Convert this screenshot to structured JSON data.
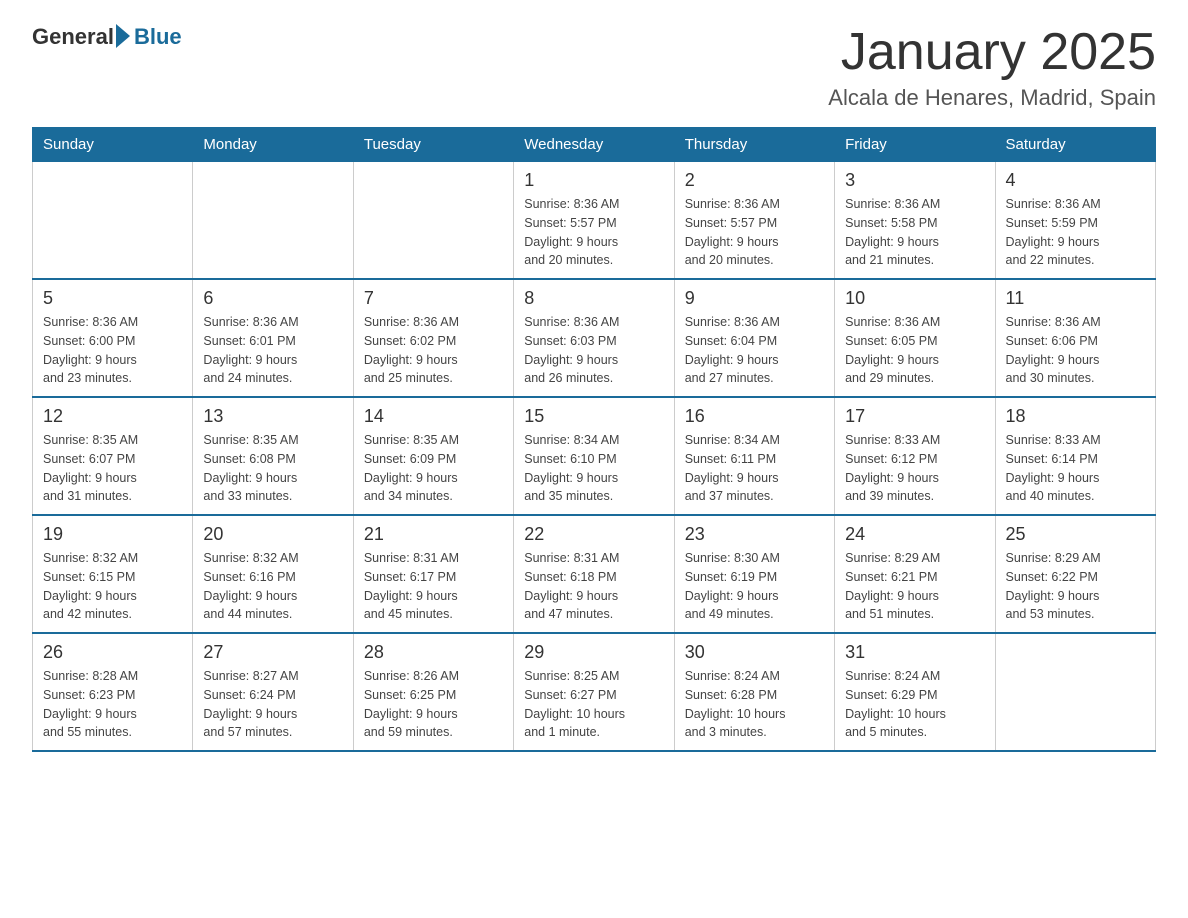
{
  "logo": {
    "text_general": "General",
    "text_blue": "Blue"
  },
  "header": {
    "title": "January 2025",
    "location": "Alcala de Henares, Madrid, Spain"
  },
  "days_of_week": [
    "Sunday",
    "Monday",
    "Tuesday",
    "Wednesday",
    "Thursday",
    "Friday",
    "Saturday"
  ],
  "weeks": [
    {
      "days": [
        {
          "num": "",
          "info": ""
        },
        {
          "num": "",
          "info": ""
        },
        {
          "num": "",
          "info": ""
        },
        {
          "num": "1",
          "info": "Sunrise: 8:36 AM\nSunset: 5:57 PM\nDaylight: 9 hours\nand 20 minutes."
        },
        {
          "num": "2",
          "info": "Sunrise: 8:36 AM\nSunset: 5:57 PM\nDaylight: 9 hours\nand 20 minutes."
        },
        {
          "num": "3",
          "info": "Sunrise: 8:36 AM\nSunset: 5:58 PM\nDaylight: 9 hours\nand 21 minutes."
        },
        {
          "num": "4",
          "info": "Sunrise: 8:36 AM\nSunset: 5:59 PM\nDaylight: 9 hours\nand 22 minutes."
        }
      ]
    },
    {
      "days": [
        {
          "num": "5",
          "info": "Sunrise: 8:36 AM\nSunset: 6:00 PM\nDaylight: 9 hours\nand 23 minutes."
        },
        {
          "num": "6",
          "info": "Sunrise: 8:36 AM\nSunset: 6:01 PM\nDaylight: 9 hours\nand 24 minutes."
        },
        {
          "num": "7",
          "info": "Sunrise: 8:36 AM\nSunset: 6:02 PM\nDaylight: 9 hours\nand 25 minutes."
        },
        {
          "num": "8",
          "info": "Sunrise: 8:36 AM\nSunset: 6:03 PM\nDaylight: 9 hours\nand 26 minutes."
        },
        {
          "num": "9",
          "info": "Sunrise: 8:36 AM\nSunset: 6:04 PM\nDaylight: 9 hours\nand 27 minutes."
        },
        {
          "num": "10",
          "info": "Sunrise: 8:36 AM\nSunset: 6:05 PM\nDaylight: 9 hours\nand 29 minutes."
        },
        {
          "num": "11",
          "info": "Sunrise: 8:36 AM\nSunset: 6:06 PM\nDaylight: 9 hours\nand 30 minutes."
        }
      ]
    },
    {
      "days": [
        {
          "num": "12",
          "info": "Sunrise: 8:35 AM\nSunset: 6:07 PM\nDaylight: 9 hours\nand 31 minutes."
        },
        {
          "num": "13",
          "info": "Sunrise: 8:35 AM\nSunset: 6:08 PM\nDaylight: 9 hours\nand 33 minutes."
        },
        {
          "num": "14",
          "info": "Sunrise: 8:35 AM\nSunset: 6:09 PM\nDaylight: 9 hours\nand 34 minutes."
        },
        {
          "num": "15",
          "info": "Sunrise: 8:34 AM\nSunset: 6:10 PM\nDaylight: 9 hours\nand 35 minutes."
        },
        {
          "num": "16",
          "info": "Sunrise: 8:34 AM\nSunset: 6:11 PM\nDaylight: 9 hours\nand 37 minutes."
        },
        {
          "num": "17",
          "info": "Sunrise: 8:33 AM\nSunset: 6:12 PM\nDaylight: 9 hours\nand 39 minutes."
        },
        {
          "num": "18",
          "info": "Sunrise: 8:33 AM\nSunset: 6:14 PM\nDaylight: 9 hours\nand 40 minutes."
        }
      ]
    },
    {
      "days": [
        {
          "num": "19",
          "info": "Sunrise: 8:32 AM\nSunset: 6:15 PM\nDaylight: 9 hours\nand 42 minutes."
        },
        {
          "num": "20",
          "info": "Sunrise: 8:32 AM\nSunset: 6:16 PM\nDaylight: 9 hours\nand 44 minutes."
        },
        {
          "num": "21",
          "info": "Sunrise: 8:31 AM\nSunset: 6:17 PM\nDaylight: 9 hours\nand 45 minutes."
        },
        {
          "num": "22",
          "info": "Sunrise: 8:31 AM\nSunset: 6:18 PM\nDaylight: 9 hours\nand 47 minutes."
        },
        {
          "num": "23",
          "info": "Sunrise: 8:30 AM\nSunset: 6:19 PM\nDaylight: 9 hours\nand 49 minutes."
        },
        {
          "num": "24",
          "info": "Sunrise: 8:29 AM\nSunset: 6:21 PM\nDaylight: 9 hours\nand 51 minutes."
        },
        {
          "num": "25",
          "info": "Sunrise: 8:29 AM\nSunset: 6:22 PM\nDaylight: 9 hours\nand 53 minutes."
        }
      ]
    },
    {
      "days": [
        {
          "num": "26",
          "info": "Sunrise: 8:28 AM\nSunset: 6:23 PM\nDaylight: 9 hours\nand 55 minutes."
        },
        {
          "num": "27",
          "info": "Sunrise: 8:27 AM\nSunset: 6:24 PM\nDaylight: 9 hours\nand 57 minutes."
        },
        {
          "num": "28",
          "info": "Sunrise: 8:26 AM\nSunset: 6:25 PM\nDaylight: 9 hours\nand 59 minutes."
        },
        {
          "num": "29",
          "info": "Sunrise: 8:25 AM\nSunset: 6:27 PM\nDaylight: 10 hours\nand 1 minute."
        },
        {
          "num": "30",
          "info": "Sunrise: 8:24 AM\nSunset: 6:28 PM\nDaylight: 10 hours\nand 3 minutes."
        },
        {
          "num": "31",
          "info": "Sunrise: 8:24 AM\nSunset: 6:29 PM\nDaylight: 10 hours\nand 5 minutes."
        },
        {
          "num": "",
          "info": ""
        }
      ]
    }
  ]
}
